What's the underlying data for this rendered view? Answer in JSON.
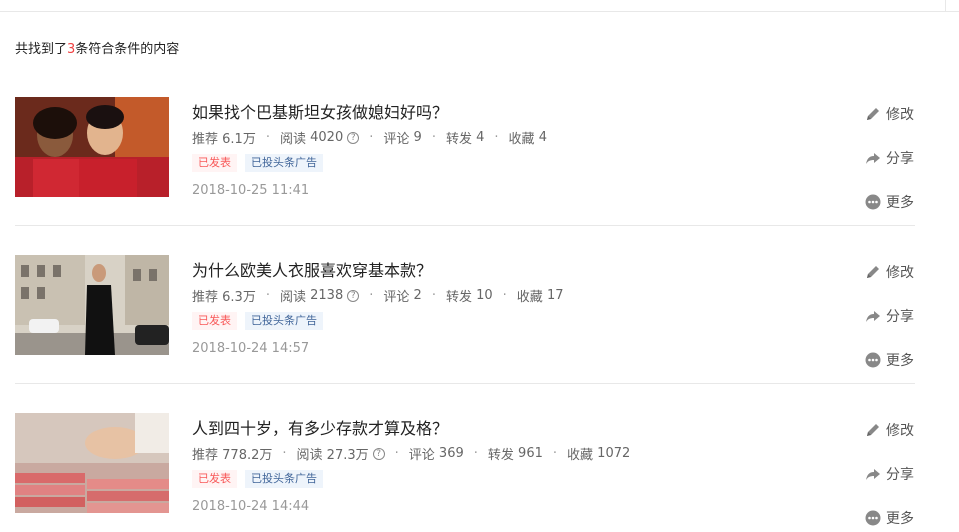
{
  "summary": {
    "prefix": "共找到了",
    "count": "3",
    "suffix": "条符合条件的内容"
  },
  "articles": [
    {
      "title": "如果找个巴基斯坦女孩做媳妇好吗？",
      "recommend_label": "推荐",
      "recommend": "6.1万",
      "read_label": "阅读",
      "read": "4020",
      "comment_label": "评论",
      "comment": "9",
      "forward_label": "转发",
      "forward": "4",
      "collect_label": "收藏",
      "collect": "4",
      "tag_published": "已发表",
      "tag_ad": "已投头条广告",
      "time": "2018-10-25 11:41"
    },
    {
      "title": "为什么欧美人衣服喜欢穿基本款？",
      "recommend_label": "推荐",
      "recommend": "6.3万",
      "read_label": "阅读",
      "read": "2138",
      "comment_label": "评论",
      "comment": "2",
      "forward_label": "转发",
      "forward": "10",
      "collect_label": "收藏",
      "collect": "17",
      "tag_published": "已发表",
      "tag_ad": "已投头条广告",
      "time": "2018-10-24 14:57"
    },
    {
      "title": "人到四十岁，有多少存款才算及格？",
      "recommend_label": "推荐",
      "recommend": "778.2万",
      "read_label": "阅读",
      "read": "27.3万",
      "comment_label": "评论",
      "comment": "369",
      "forward_label": "转发",
      "forward": "961",
      "collect_label": "收藏",
      "collect": "1072",
      "tag_published": "已发表",
      "tag_ad": "已投头条广告",
      "time": "2018-10-24 14:44"
    }
  ],
  "actions": {
    "edit": "修改",
    "share": "分享",
    "more": "更多"
  },
  "icons": {
    "edit": "pencil-icon",
    "share": "share-arrow-icon",
    "more": "more-dots-icon",
    "help": "question-circle-icon"
  },
  "colors": {
    "accent_red": "#f04142",
    "tag_published": "#f85959",
    "tag_ad": "#406599",
    "meta_gray": "#999999"
  }
}
